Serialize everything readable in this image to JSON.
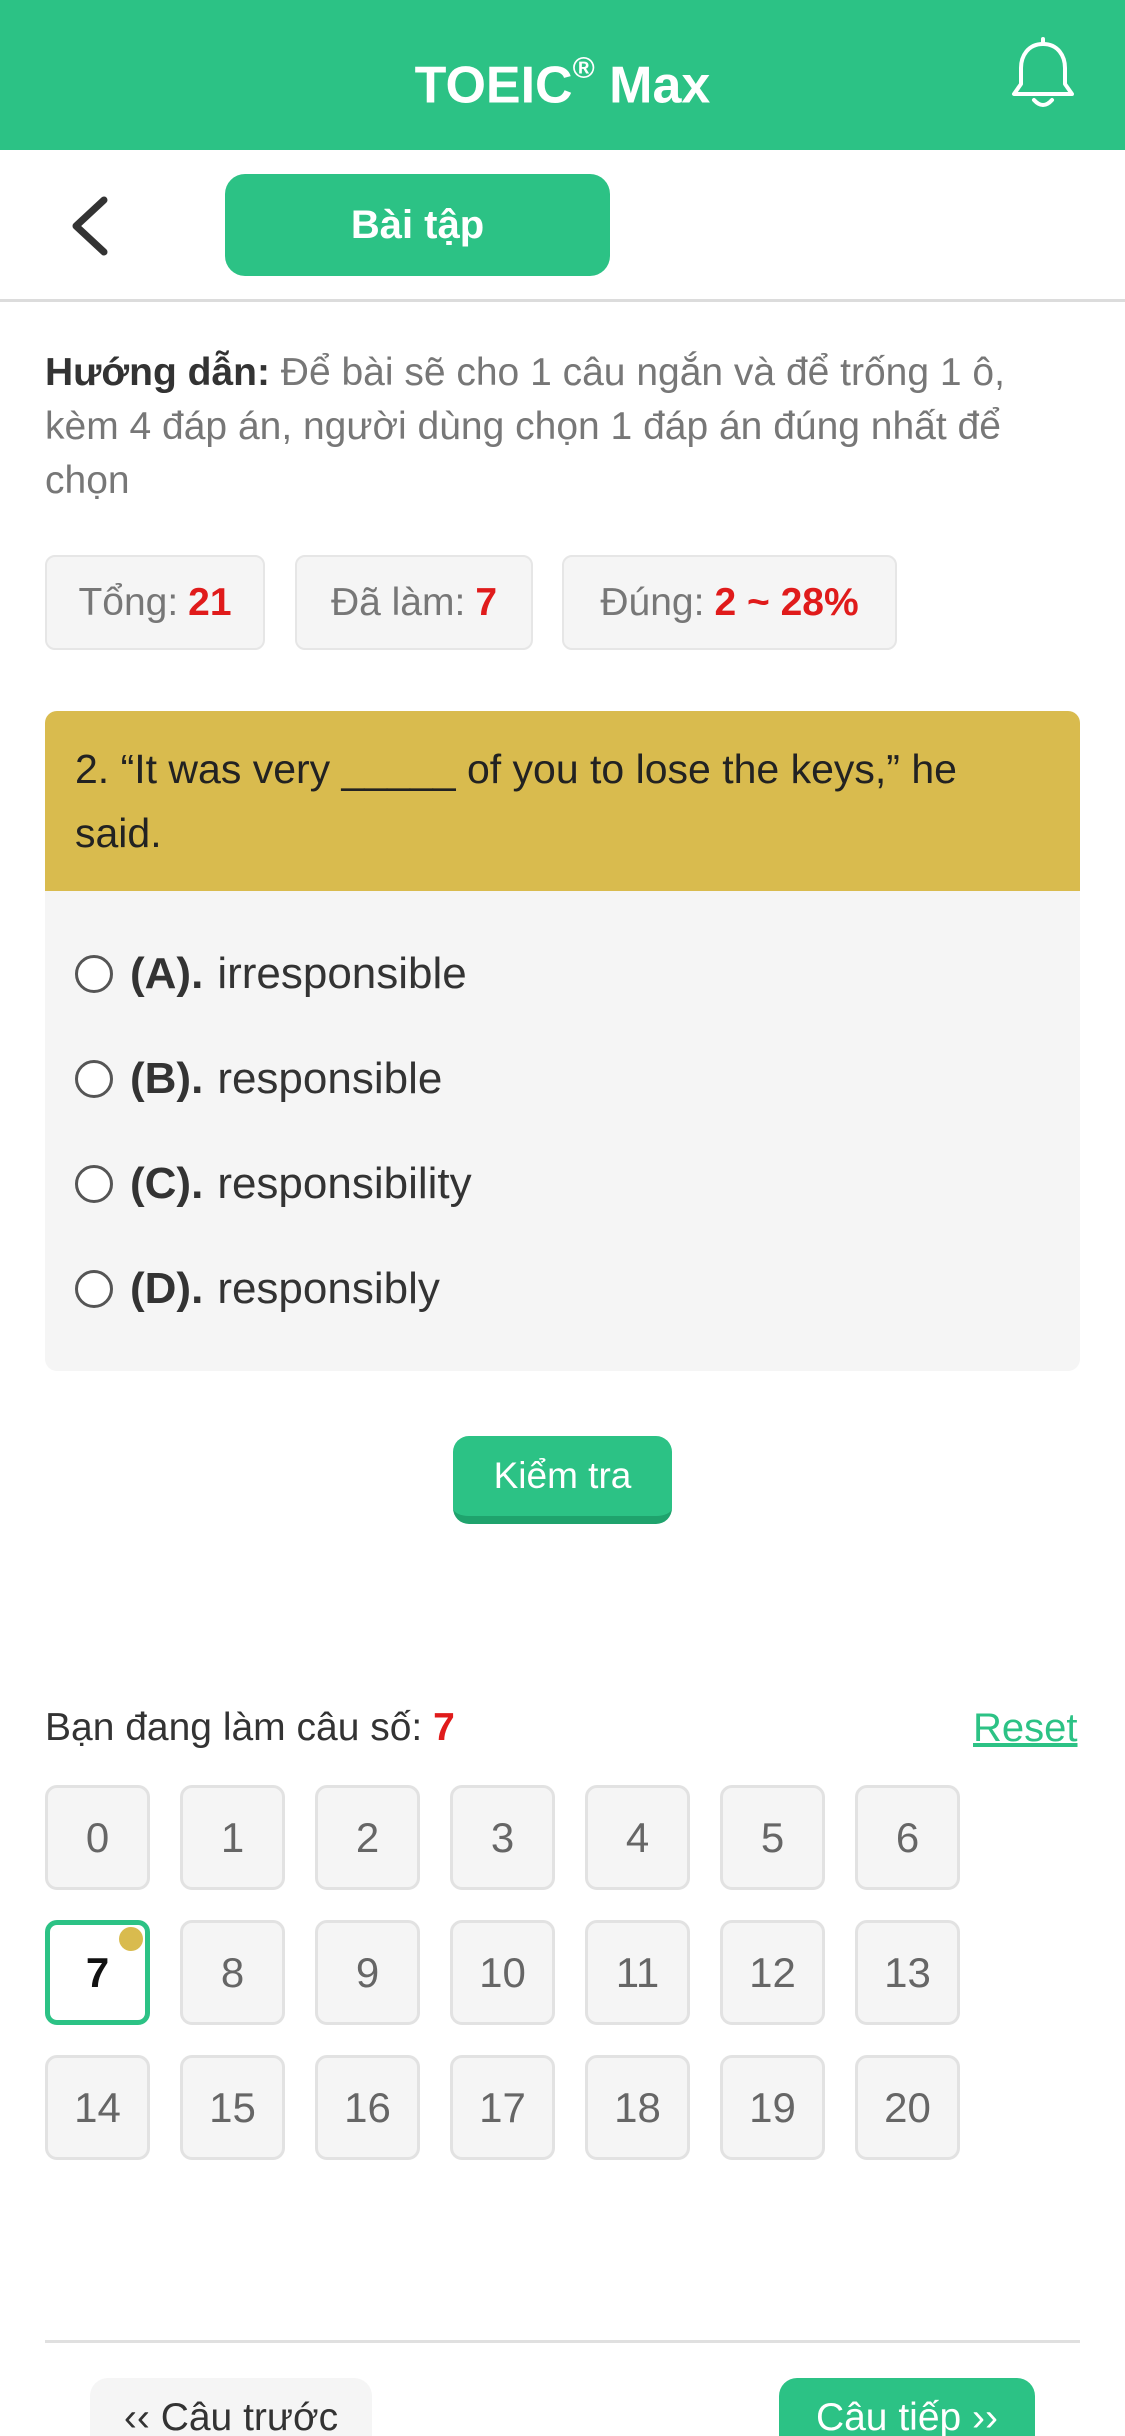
{
  "header": {
    "title": "TOEIC",
    "title_mark": "®",
    "title_suffix": " Max",
    "bell_icon": "bell-icon"
  },
  "subbar": {
    "back_icon": "chevron-left-icon",
    "tab_label": "Bài tập"
  },
  "instructions": {
    "label": "Hướng dẫn:",
    "text": " Để bài sẽ cho 1 câu ngắn và để trống 1 ô, kèm 4 đáp án, người dùng chọn 1 đáp án đúng nhất để chọn"
  },
  "stats": [
    {
      "label": "Tổng:",
      "value": "21"
    },
    {
      "label": "Đã làm:",
      "value": "7"
    },
    {
      "label": "Đúng:",
      "value": "2 ~ 28%"
    }
  ],
  "question": {
    "text": "2. “It was very _____ of you to lose the keys,” he said.",
    "options": [
      {
        "key": "(A).",
        "text": "irresponsible"
      },
      {
        "key": "(B).",
        "text": "responsible"
      },
      {
        "key": "(C).",
        "text": "responsibility"
      },
      {
        "key": "(D).",
        "text": "responsibly"
      }
    ]
  },
  "check_label": "Kiểm tra",
  "progress": {
    "label": "Bạn đang làm câu số:",
    "current": "7",
    "reset_label": "Reset"
  },
  "grid": {
    "numbers": [
      "0",
      "1",
      "2",
      "3",
      "4",
      "5",
      "6",
      "7",
      "8",
      "9",
      "10",
      "11",
      "12",
      "13",
      "14",
      "15",
      "16",
      "17",
      "18",
      "19",
      "20"
    ],
    "active": "7"
  },
  "nav": {
    "prev_label": "‹‹ Câu trước",
    "next_label": "Câu tiếp ››"
  },
  "colors": {
    "brand": "#2cc285",
    "question_header": "#d9bb4e",
    "accent_red": "#e01b1b"
  }
}
